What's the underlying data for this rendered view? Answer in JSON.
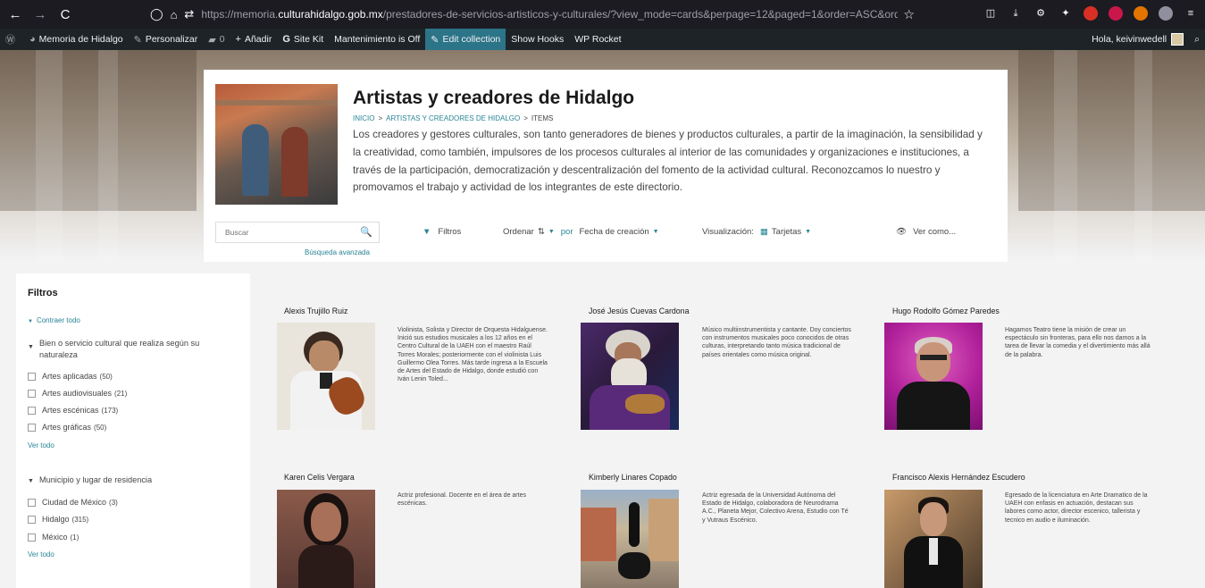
{
  "browser": {
    "back": "←",
    "forward": "→",
    "reload": "C",
    "url_prefix": "https://memoria.",
    "url_domain": "culturahidalgo.gob.mx",
    "url_path": "/prestadores-de-servicios-artisticos-y-culturales/?view_mode=cards&perpage=12&paged=1&order=ASC&orderby=date&fetch_only=thumbna"
  },
  "admin_bar": {
    "site_name": "Memoria de Hidalgo",
    "customize": "Personalizar",
    "comments_count": "0",
    "add_new": "Añadir",
    "site_kit": "Site Kit",
    "maintenance": "Mantenimiento is Off",
    "edit_collection": "Edit collection",
    "show_hooks": "Show Hooks",
    "wp_rocket": "WP Rocket",
    "greeting": "Hola, keivinwedell"
  },
  "header": {
    "title": "Artistas y creadores de Hidalgo",
    "breadcrumb": [
      "INICIO",
      "ARTISTAS Y CREADORES DE HIDALGO",
      "ITEMS"
    ],
    "breadcrumb_sep": ">",
    "description": "Los creadores y gestores culturales, son tanto generadores de bienes y productos culturales, a partir de la imaginación, la sensibilidad y la creatividad, como también, impulsores de los procesos culturales al interior de las comunidades y organizaciones e instituciones, a través de la participación, democratización y descentralización del fomento de la actividad cultural. Reconozcamos lo nuestro y promovamos el trabajo y actividad de los integrantes de este directorio."
  },
  "controls": {
    "search_placeholder": "Buscar",
    "advanced_search": "Búsqueda avanzada",
    "filters": "Filtros",
    "sort_label": "Ordenar",
    "sort_by": "por",
    "sort_field": "Fecha de creación",
    "view_label": "Visualización:",
    "view_mode": "Tarjetas",
    "view_as": "Ver como..."
  },
  "sidebar": {
    "title": "Filtros",
    "collapse_all": "Contraer todo",
    "groups": [
      {
        "label": "Bien o servicio cultural que realiza según su naturaleza",
        "options": [
          {
            "label": "Artes aplicadas",
            "count": "(50)"
          },
          {
            "label": "Artes audiovisuales",
            "count": "(21)"
          },
          {
            "label": "Artes escénicas",
            "count": "(173)"
          },
          {
            "label": "Artes gráficas",
            "count": "(50)"
          }
        ],
        "more": "Ver todo"
      },
      {
        "label": "Municipio y lugar de residencia",
        "options": [
          {
            "label": "Ciudad de México",
            "count": "(3)"
          },
          {
            "label": "Hidalgo",
            "count": "(315)"
          },
          {
            "label": "México",
            "count": "(1)"
          }
        ],
        "more": "Ver todo"
      }
    ]
  },
  "items": [
    {
      "name": "Alexis Trujillo Ruiz",
      "description": "Violinista, Solista y Director de Orquesta Hidalguense. Inició sus estudios musicales a los 12 años en el Centro Cultural de la UAEH con el maestro Raúl Torres Morales; posteriormente con el violinista Luis Guillermo Olea Torres. Más tarde ingresa a la Escuela de Artes del Estado de Hidalgo, donde estudió con Iván Lenin Toled..."
    },
    {
      "name": "José Jesús Cuevas Cardona",
      "description": "Músico multiinstrumentista y cantante. Doy conciertos con instrumentos musicales poco conocidos de otras culturas, interpretando tanto música tradicional de países orientales como música original."
    },
    {
      "name": "Hugo Rodolfo Gómez Paredes",
      "description": "Hagamos Teatro tiene la misión de crear un espectáculo sin fronteras, para ello nos damos a la tarea de llevar la comedia y el divertimiento más allá de la palabra."
    },
    {
      "name": "Karen Celis Vergara",
      "description": "Actriz profesional. Docente en el área de artes escénicas."
    },
    {
      "name": "Kimberly Linares Copado",
      "description": "Actriz egresada de la Universidad Autónoma del Estado de Hidalgo, colaboradora de Neurodrama A.C., Planeta Mejor, Colectivo Arena, Estudio con Té y Vutraus Escénico."
    },
    {
      "name": "Francisco Alexis Hernández Escudero",
      "description": "Egresado de la licenciatura en Arte Dramatico de la UAEH con enfasis en actuación, destacan sus labores como actor, director escenico, tallerista y tecnico en audio e iluminación."
    }
  ],
  "colors": {
    "accent": "#298596",
    "browser_bg": "#1c1b22",
    "admin_bg": "#1d2327",
    "edit_collection_bg": "#2c7488"
  }
}
